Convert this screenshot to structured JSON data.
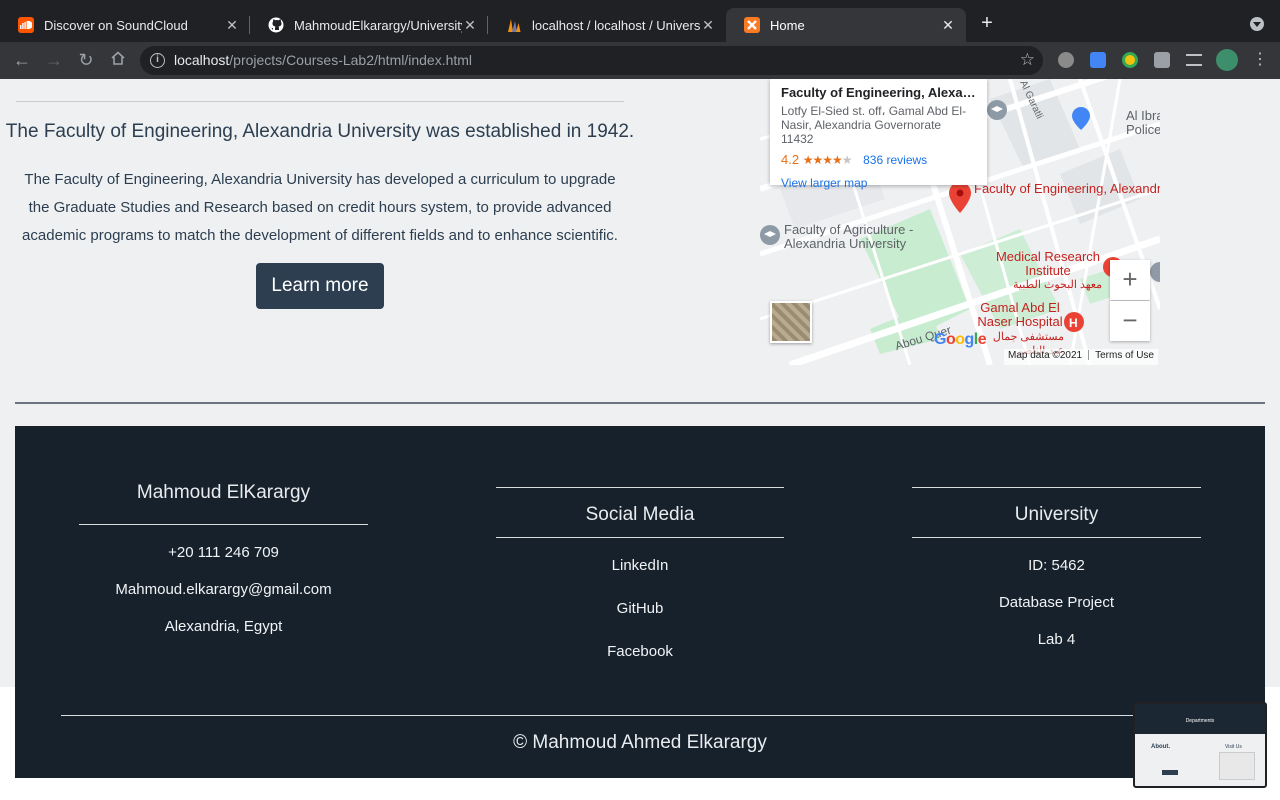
{
  "browser": {
    "tabs": [
      {
        "label": "Discover on SoundCloud",
        "icon": "soundcloud-icon",
        "color": "#ff5500",
        "active": false
      },
      {
        "label": "MahmoudElkarargy/University-",
        "icon": "github-icon",
        "color": "#ffffff",
        "active": false
      },
      {
        "label": "localhost / localhost / Universit",
        "icon": "phpmyadmin-icon",
        "color": "#f29111",
        "active": false
      },
      {
        "label": "Home",
        "icon": "xampp-icon",
        "color": "#fb7a24",
        "active": true
      }
    ],
    "url_host": "localhost",
    "url_path": "/projects/Courses-Lab2/html/index.html"
  },
  "about": {
    "heading": "The Faculty of Engineering, Alexandria University was established in 1942.",
    "body": "The Faculty of Engineering, Alexandria University has developed a curriculum to upgrade the Graduate Studies and Research based on credit hours system, to provide advanced academic programs to match the development of different fields and to enhance scientific.",
    "button": "Learn more"
  },
  "map": {
    "card_title": "Faculty of Engineering, Alexan...",
    "card_address": "Lotfy El-Sied st. off، Gamal Abd El-Nasir, Alexandria Governorate 11432",
    "rating": "4.2",
    "stars_filled": 4,
    "reviews": "836 reviews",
    "larger_map": "View larger map",
    "labels": {
      "faculty_eng": "Faculty of Engineering, Alexandria University",
      "faculty_agri": "Faculty of Agriculture - Alexandria University",
      "medical": "Medical Research Institute",
      "medical_ar": "معهد البحوث الطبية",
      "hospital": "Gamal Abd El Naser Hospital",
      "hospital_ar": "مستشفى جمال عبد الناصر",
      "al_ibra": "Al Ibra",
      "police": "Police",
      "abou_quer": "Abou Quer",
      "al_garatli": "Al Garatli"
    },
    "zoom_in": "+",
    "zoom_out": "−",
    "google": "Google",
    "map_data": "Map data ©2021",
    "terms": "Terms of Use"
  },
  "footer": {
    "contact": {
      "title": "Mahmoud ElKarargy",
      "phone": "+20 111 246 709",
      "email": "Mahmoud.elkarargy@gmail.com",
      "location": "Alexandria, Egypt"
    },
    "social": {
      "title": "Social Media",
      "links": [
        "LinkedIn",
        "GitHub",
        "Facebook"
      ]
    },
    "university": {
      "title": "University",
      "items": [
        "ID: 5462",
        "Database Project",
        "Lab 4"
      ]
    },
    "copyright": "© Mahmoud Ahmed Elkarargy"
  },
  "preview": {
    "title": "Departments",
    "about": "About.",
    "visit": "Visit Us"
  }
}
